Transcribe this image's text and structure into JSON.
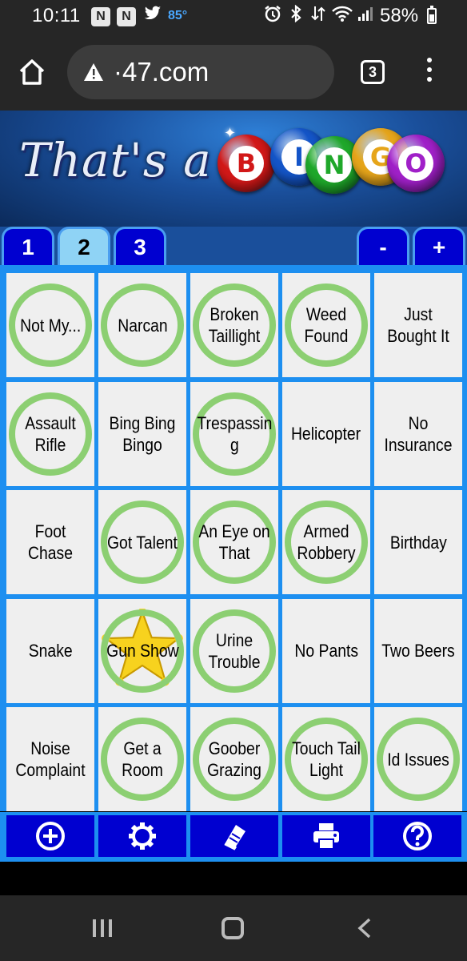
{
  "status_bar": {
    "time": "10:11",
    "notif_1": "N",
    "notif_2": "N",
    "twitter_icon": "twitter-icon",
    "temperature": "85°",
    "alarm_icon": "alarm-icon",
    "bluetooth_icon": "bluetooth-icon",
    "wifi_icon": "wifi-icon",
    "signal_icon": "signal-icon",
    "battery_percent": "58%",
    "battery_level": 0.58
  },
  "browser": {
    "home_icon": "home-icon",
    "warning_icon": "warning-icon",
    "url": "·47.com",
    "tab_count": "3",
    "menu_icon": "more-vert-icon"
  },
  "game": {
    "banner_title": "That's a",
    "bingo_letters": [
      "B",
      "I",
      "N",
      "G",
      "O"
    ],
    "ball_colors": [
      "#d21818",
      "#1455c8",
      "#1fa82a",
      "#e6a51a",
      "#a020c8"
    ],
    "tabs": [
      {
        "label": "1",
        "active": false
      },
      {
        "label": "2",
        "active": true
      },
      {
        "label": "3",
        "active": false
      }
    ],
    "zoom_minus": "-",
    "zoom_plus": "+",
    "cells": [
      {
        "label": "Not My...",
        "marked": true
      },
      {
        "label": "Narcan",
        "marked": true
      },
      {
        "label": "Broken Taillight",
        "marked": true
      },
      {
        "label": "Weed Found",
        "marked": true
      },
      {
        "label": "Just Bought It",
        "marked": false
      },
      {
        "label": "Assault Rifle",
        "marked": true
      },
      {
        "label": "Bing Bing Bingo",
        "marked": false
      },
      {
        "label": "Trespassin g",
        "marked": true
      },
      {
        "label": "Helicopter",
        "marked": false
      },
      {
        "label": "No Insurance",
        "marked": false
      },
      {
        "label": "Foot Chase",
        "marked": false
      },
      {
        "label": "Got Talent",
        "marked": true
      },
      {
        "label": "An Eye on That",
        "marked": true
      },
      {
        "label": "Armed Robbery",
        "marked": true
      },
      {
        "label": "Birthday",
        "marked": false
      },
      {
        "label": "Snake",
        "marked": false
      },
      {
        "label": "Gun Show",
        "marked": true,
        "free_star": true
      },
      {
        "label": "Urine Trouble",
        "marked": true
      },
      {
        "label": "No Pants",
        "marked": false
      },
      {
        "label": "Two Beers",
        "marked": false
      },
      {
        "label": "Noise Complaint",
        "marked": false
      },
      {
        "label": "Get a Room",
        "marked": true
      },
      {
        "label": "Goober Grazing",
        "marked": true
      },
      {
        "label": "Touch Tail Light",
        "marked": true
      },
      {
        "label": "Id Issues",
        "marked": true
      }
    ],
    "mark_color": "#8ccf72",
    "toolbar_icons": [
      "add-circle-icon",
      "gear-icon",
      "book-icon",
      "printer-icon",
      "help-icon"
    ]
  },
  "android_nav": {
    "recents_icon": "recents-icon",
    "home_icon": "nav-home-icon",
    "back_icon": "back-icon"
  }
}
